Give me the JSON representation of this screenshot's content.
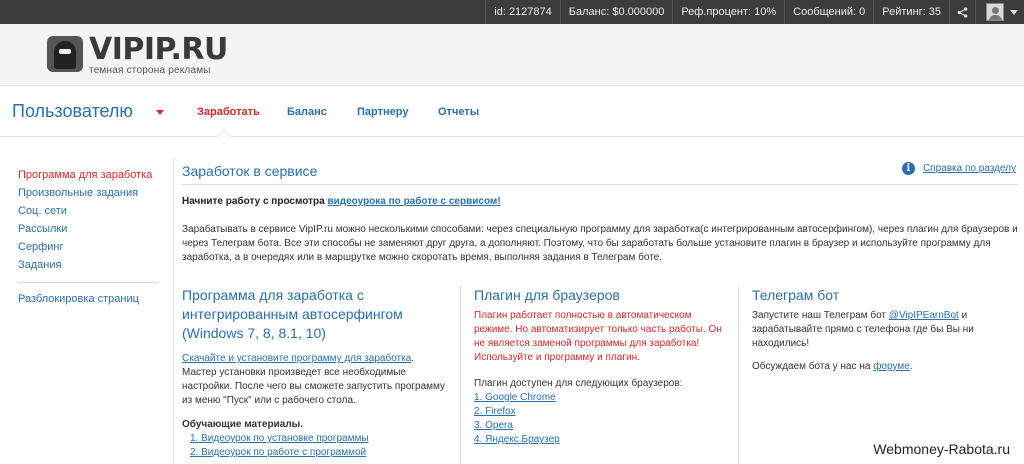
{
  "topbar": {
    "id": "id: 2127874",
    "balance": "Баланс: $0.000000",
    "ref": "Реф.процент: 10%",
    "messages": "Сообщений: 0",
    "rating": "Рейтинг: 35"
  },
  "logo": {
    "title": "VIPIP.RU",
    "subtitle": "темная сторона рекламы"
  },
  "nav": {
    "title": "Пользователю",
    "items": [
      "Заработать",
      "Баланс",
      "Партнеру",
      "Отчеты"
    ]
  },
  "sidebar": {
    "items": [
      "Программа для заработка",
      "Произвольные задания",
      "Соц. сети",
      "Рассылки",
      "Серфинг",
      "Задания"
    ],
    "extra": "Разблокировка страниц"
  },
  "main": {
    "title": "Заработок в сервисе",
    "help": "Справка по разделу",
    "intro_prefix": "Начните работу с просмотра ",
    "intro_link": "видеоурока по работе с сервисом!",
    "description": "Зарабатывать в сервисе VipIP.ru можно несколькими способами: через специальную программу для заработка(с интегрированным автосерфингом), через плагин для браузеров и через Телеграм бота. Все эти способы не заменяют друг друга, а дополняют. Поэтому, что бы заработать больше установите плагин в браузер и используйте программу для заработка, а в очередях или в маршрутке можно скоротать время, выполняя задания в Телеграм боте."
  },
  "col1": {
    "heading": "Программа для заработка с интегрированным автосерфингом (Windows 7, 8, 8.1, 10)",
    "download_link": "Скачайте и установите программу для заработка",
    "text": "Мастер установки произведет все необходимые настройки. После чего вы сможете запустить программу из меню \"Пуск\" или с рабочего стола.",
    "materials_title": "Обучающие материалы.",
    "materials": [
      "1. Видеоурок по установке программы",
      "2. Видеоурок по работе с программой"
    ]
  },
  "col2": {
    "heading": "Плагин для браузеров",
    "red_text": "Плагин работает полностью в автоматическом режиме. Но автоматизирует только часть работы. Он не является заменой программы для заработка! Используйте и программу и плагин.",
    "browsers_title": "Плагин доступен для следующих браузеров:",
    "browsers": [
      "1. Google Chrome",
      "2. Firefox",
      "3. Opera",
      "4. Яндекс.Браузер"
    ]
  },
  "col3": {
    "heading": "Телеграм бот",
    "text_prefix": "Запустите наш Телеграм бот ",
    "bot_link": "@VipIPEarnBot",
    "text_suffix": " и зарабатывайте прямо с телефона где бы Вы ни находились!",
    "forum_prefix": "Обсуждаем бота у нас на ",
    "forum_link": "форуме",
    "forum_suffix": "."
  },
  "watermark": "Webmoney-Rabota.ru",
  "colors": {
    "link": "#2a6fae",
    "accent": "#d9282a",
    "topbar": "#3c3c3c"
  }
}
